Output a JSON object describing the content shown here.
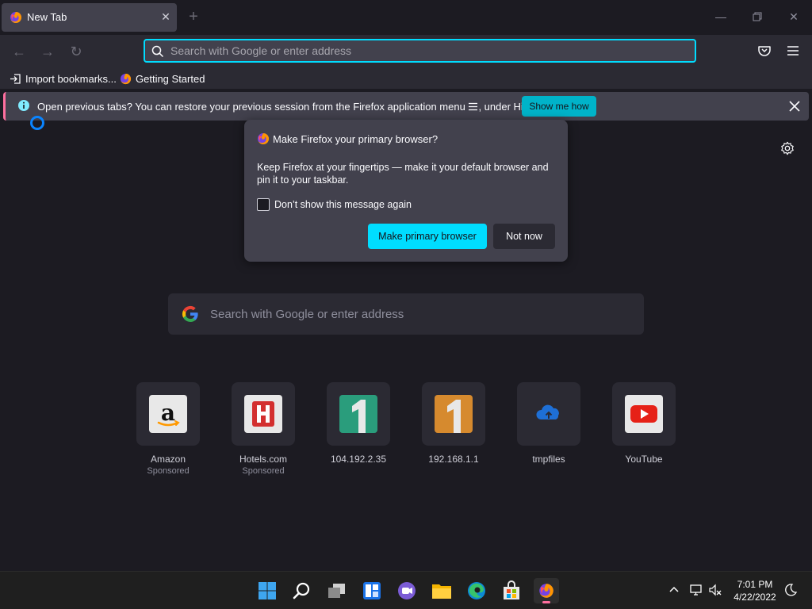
{
  "tab": {
    "title": "New Tab"
  },
  "urlbar": {
    "placeholder": "Search with Google or enter address"
  },
  "bookmarks": [
    {
      "label": "Import bookmarks..."
    },
    {
      "label": "Getting Started"
    }
  ],
  "notification": {
    "bold": "Open previous tabs?",
    "text": "You can restore your previous session from the Firefox application menu",
    "text_after": ", under History.",
    "button": "Show me how"
  },
  "popup": {
    "title": "Make Firefox your primary browser?",
    "body": "Keep Firefox at your fingertips — make it your default browser and pin it to your taskbar.",
    "checkbox_label": "Don’t show this message again",
    "checkbox_checked": false,
    "primary_button": "Make primary browser",
    "secondary_button": "Not now"
  },
  "content_search": {
    "placeholder": "Search with Google or enter address"
  },
  "top_sites": [
    {
      "name": "Amazon",
      "sponsor": "Sponsored",
      "icon": "amazon-icon"
    },
    {
      "name": "Hotels.com",
      "sponsor": "Sponsored",
      "icon": "hotels-icon"
    },
    {
      "name": "104.192.2.35",
      "sponsor": "",
      "icon": "number-one-icon"
    },
    {
      "name": "192.168.1.1",
      "sponsor": "",
      "icon": "number-one-icon"
    },
    {
      "name": "tmpfiles",
      "sponsor": "",
      "icon": "cloud-icon"
    },
    {
      "name": "YouTube",
      "sponsor": "",
      "icon": "youtube-icon"
    }
  ],
  "taskbar": {
    "time": "7:01 PM",
    "date": "4/22/2022"
  },
  "colors": {
    "accent": "#00ddff",
    "notification_accent": "#ff6f9f",
    "background": "#1c1b22"
  }
}
